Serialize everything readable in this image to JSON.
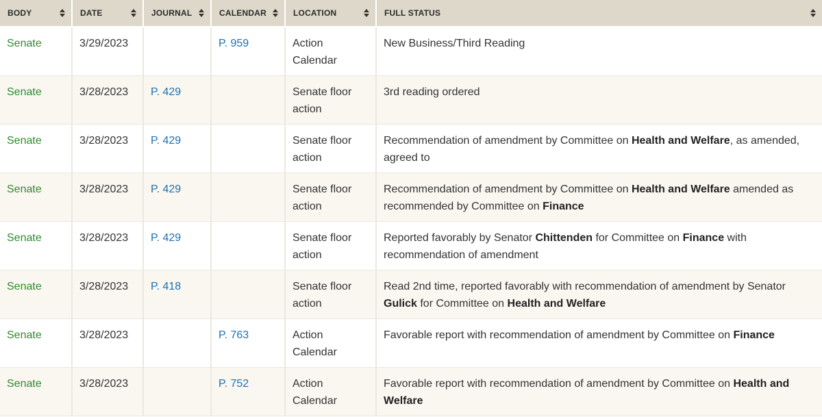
{
  "table": {
    "headers": [
      {
        "label": "BODY"
      },
      {
        "label": "DATE"
      },
      {
        "label": "JOURNAL"
      },
      {
        "label": "CALENDAR"
      },
      {
        "label": "LOCATION"
      },
      {
        "label": "FULL STATUS"
      }
    ],
    "sort_icon": "sort-icon",
    "colors": {
      "header_bg": "#ddd8c9",
      "body_link": "#2e8b2e",
      "page_link": "#1f6fb0",
      "alt_row_bg": "#f9f7f0"
    },
    "rows": [
      {
        "body": "Senate",
        "date": "3/29/2023",
        "journal": "",
        "calendar": "P. 959",
        "location": "Action Calendar",
        "status": [
          {
            "t": "New Business/Third Reading",
            "b": false
          }
        ]
      },
      {
        "body": "Senate",
        "date": "3/28/2023",
        "journal": "P. 429",
        "calendar": "",
        "location": "Senate floor action",
        "status": [
          {
            "t": "3rd reading ordered",
            "b": false
          }
        ]
      },
      {
        "body": "Senate",
        "date": "3/28/2023",
        "journal": "P. 429",
        "calendar": "",
        "location": "Senate floor action",
        "status": [
          {
            "t": "Recommendation of amendment by Committee on ",
            "b": false
          },
          {
            "t": "Health and Welfare",
            "b": true
          },
          {
            "t": ", as amended, agreed to",
            "b": false
          }
        ]
      },
      {
        "body": "Senate",
        "date": "3/28/2023",
        "journal": "P. 429",
        "calendar": "",
        "location": "Senate floor action",
        "status": [
          {
            "t": "Recommendation of amendment by Committee on ",
            "b": false
          },
          {
            "t": "Health and Welfare",
            "b": true
          },
          {
            "t": " amended as recommended by Committee on ",
            "b": false
          },
          {
            "t": "Finance",
            "b": true
          }
        ]
      },
      {
        "body": "Senate",
        "date": "3/28/2023",
        "journal": "P. 429",
        "calendar": "",
        "location": "Senate floor action",
        "status": [
          {
            "t": "Reported favorably by Senator ",
            "b": false
          },
          {
            "t": "Chittenden",
            "b": true
          },
          {
            "t": " for Committee on ",
            "b": false
          },
          {
            "t": "Finance",
            "b": true
          },
          {
            "t": " with recommendation of amendment",
            "b": false
          }
        ]
      },
      {
        "body": "Senate",
        "date": "3/28/2023",
        "journal": "P. 418",
        "calendar": "",
        "location": "Senate floor action",
        "status": [
          {
            "t": "Read 2nd time, reported favorably with recommendation of amendment by Senator ",
            "b": false
          },
          {
            "t": "Gulick",
            "b": true
          },
          {
            "t": " for Committee on ",
            "b": false
          },
          {
            "t": "Health and Welfare",
            "b": true
          }
        ]
      },
      {
        "body": "Senate",
        "date": "3/28/2023",
        "journal": "",
        "calendar": "P. 763",
        "location": "Action Calendar",
        "status": [
          {
            "t": "Favorable report with recommendation of amendment by Committee on ",
            "b": false
          },
          {
            "t": "Finance",
            "b": true
          }
        ]
      },
      {
        "body": "Senate",
        "date": "3/28/2023",
        "journal": "",
        "calendar": "P. 752",
        "location": "Action Calendar",
        "status": [
          {
            "t": "Favorable report with recommendation of amendment by Committee on ",
            "b": false
          },
          {
            "t": "Health and Welfare",
            "b": true
          }
        ]
      }
    ]
  }
}
